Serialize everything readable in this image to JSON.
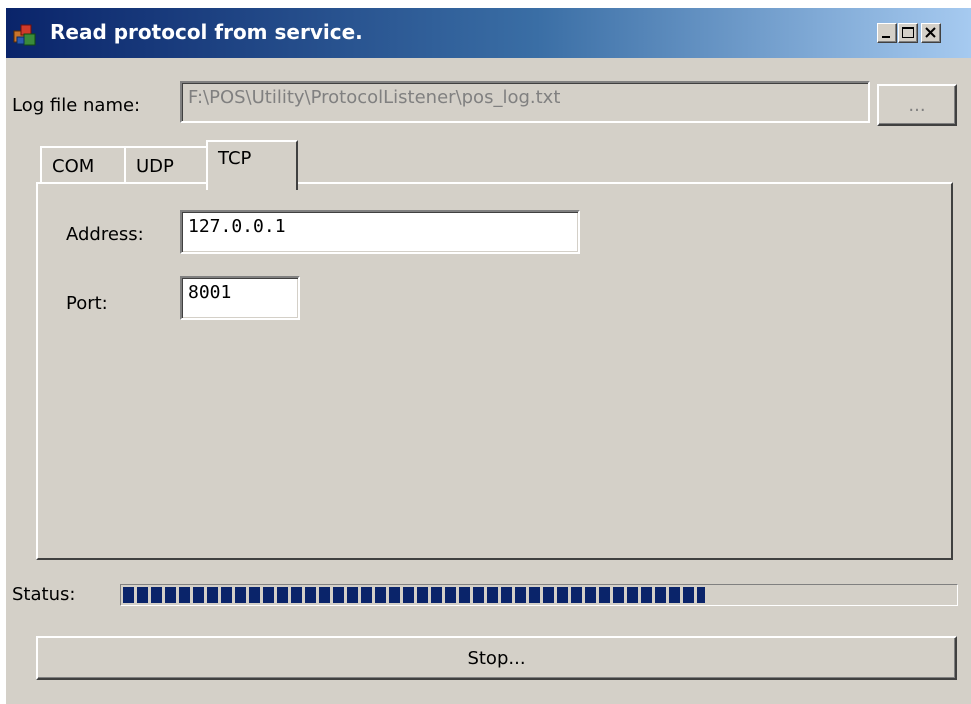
{
  "window": {
    "title": "Read protocol from service.",
    "icon": "app-icon",
    "controls": [
      "minimize-icon",
      "maximize-icon",
      "close-icon"
    ]
  },
  "log_file": {
    "label": "Log file name:",
    "value": "F:\\POS\\Utility\\ProtocolListener\\pos_log.txt",
    "browse_label": "..."
  },
  "tabs": [
    {
      "label": "COM",
      "active": false
    },
    {
      "label": "UDP",
      "active": false
    },
    {
      "label": "TCP",
      "active": true
    }
  ],
  "tcp": {
    "address_label": "Address:",
    "address_value": "127.0.0.1",
    "port_label": "Port:",
    "port_value": "8001"
  },
  "status": {
    "label": "Status:",
    "progress_percent": 70
  },
  "stop_button": {
    "label": "Stop..."
  },
  "colors": {
    "face": "#d4d0c8",
    "titlebar_start": "#0a246a",
    "titlebar_end": "#a6caf0",
    "progress": "#0a246a"
  }
}
